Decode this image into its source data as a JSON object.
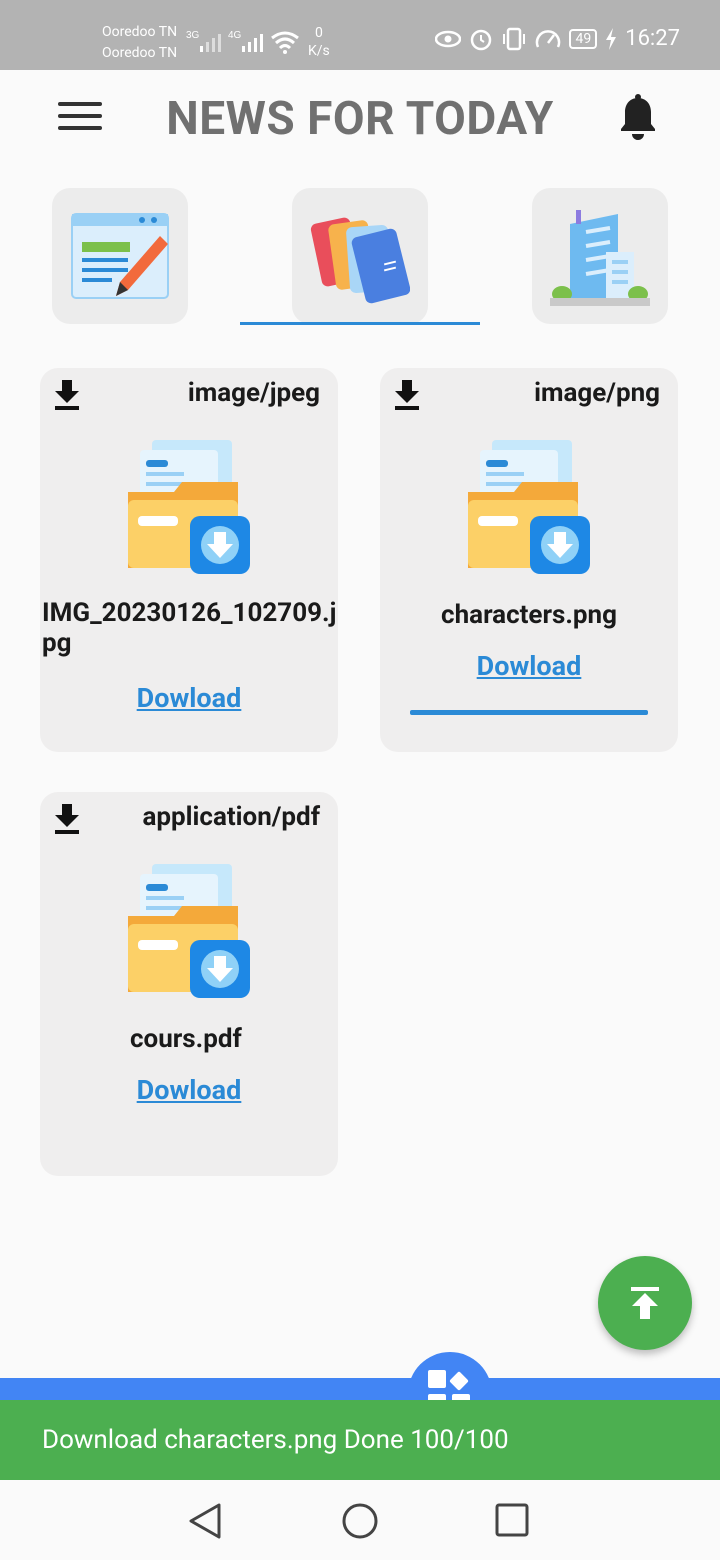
{
  "status_bar": {
    "carrier1": "Ooredoo TN",
    "carrier2": "Ooredoo TN",
    "sig1_label": "3G",
    "sig2_label": "4G",
    "speed_value": "0",
    "speed_unit": "K/s",
    "battery": "49",
    "time": "16:27"
  },
  "app_bar": {
    "title": "NEWS FOR TODAY"
  },
  "categories": [
    {
      "icon": "article-edit-icon",
      "selected": false
    },
    {
      "icon": "books-icon",
      "selected": true
    },
    {
      "icon": "building-icon",
      "selected": false
    }
  ],
  "files": [
    {
      "mime": "image/jpeg",
      "name": "IMG_20230126_102709.jpg",
      "link": "Dowload"
    },
    {
      "mime": "image/png",
      "name": "characters.png",
      "link": "Dowload",
      "progress": 1.0
    },
    {
      "mime": "application/pdf",
      "name": "cours.pdf",
      "link": "Dowload"
    }
  ],
  "snackbar": {
    "message": "Download characters.png Done 100/100"
  },
  "colors": {
    "accent": "#2b8ad6",
    "fab": "#4caf50",
    "nav": "#4285f4"
  }
}
